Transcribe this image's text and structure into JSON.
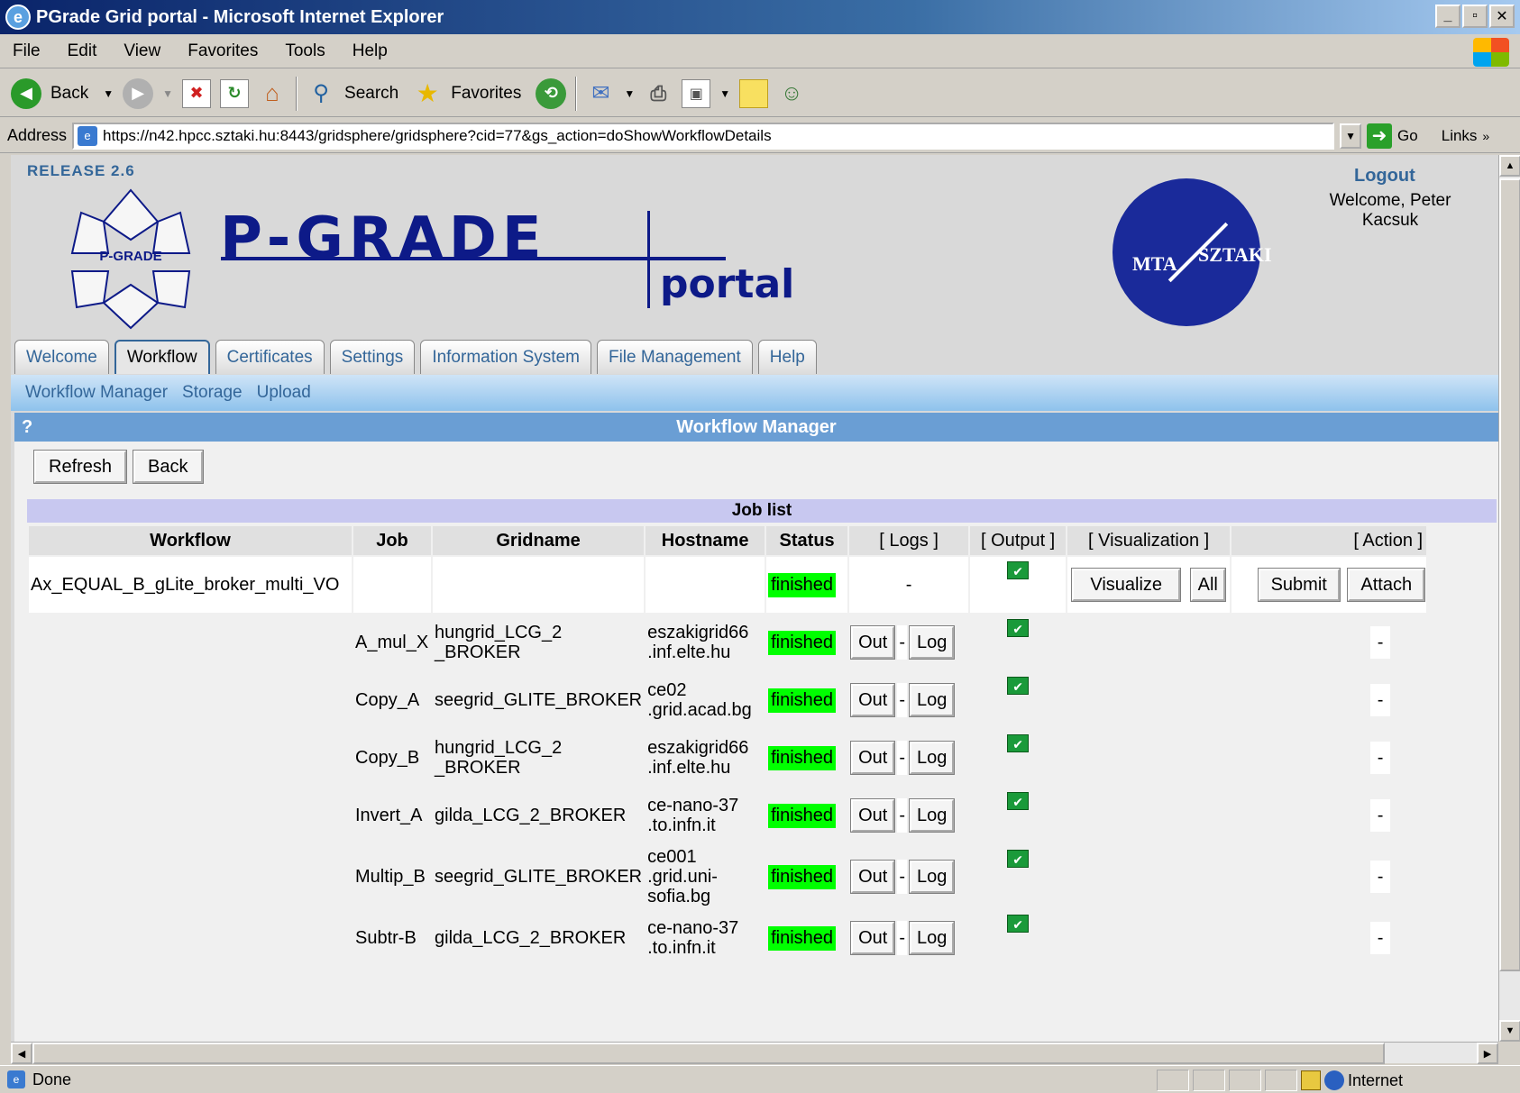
{
  "window": {
    "title": "PGrade Grid portal - Microsoft Internet Explorer"
  },
  "menu": [
    "File",
    "Edit",
    "View",
    "Favorites",
    "Tools",
    "Help"
  ],
  "toolbar": {
    "back": "Back",
    "search": "Search",
    "favorites": "Favorites"
  },
  "address": {
    "label": "Address",
    "url": "https://n42.hpcc.sztaki.hu:8443/gridsphere/gridsphere?cid=77&gs_action=doShowWorkflowDetails",
    "go": "Go",
    "links": "Links"
  },
  "page": {
    "release": "RELEASE 2.6",
    "logout": "Logout",
    "welcome": "Welcome, Peter Kacsuk",
    "logo": {
      "main": "P-GRADE",
      "sub": "portal",
      "mark": "P-GRADE",
      "mta_left": "MTA",
      "mta_right": "SZTAKI"
    },
    "tabs": [
      "Welcome",
      "Workflow",
      "Certificates",
      "Settings",
      "Information System",
      "File Management",
      "Help"
    ],
    "active_tab": "Workflow",
    "subnav": [
      "Workflow Manager",
      "Storage",
      "Upload"
    ],
    "panel": {
      "help": "?",
      "title": "Workflow Manager",
      "buttons": {
        "refresh": "Refresh",
        "back": "Back"
      },
      "job_list_title": "Job list",
      "headers": {
        "workflow": "Workflow",
        "job": "Job",
        "gridname": "Gridname",
        "hostname": "Hostname",
        "status": "Status",
        "logs": "[ Logs ]",
        "output": "[ Output ]",
        "visualization": "[ Visualization ]",
        "action": "[ Action ]"
      },
      "workflow_row": {
        "name": "Ax_EQUAL_B_gLite_broker_multi_VO",
        "status": "finished",
        "logs": "-",
        "visualize": "Visualize",
        "all": "All",
        "submit": "Submit",
        "attach": "Attach"
      },
      "jobs": [
        {
          "job": "A_mul_X",
          "gridname": "hungrid_LCG_2\n_BROKER",
          "hostname": "eszakigrid66\n.inf.elte.hu",
          "status": "finished",
          "out": "Out",
          "sep": "-",
          "log": "Log",
          "action": "-"
        },
        {
          "job": "Copy_A",
          "gridname": "seegrid_GLITE_BROKER",
          "hostname": "ce02\n.grid.acad.bg",
          "status": "finished",
          "out": "Out",
          "sep": "-",
          "log": "Log",
          "action": "-"
        },
        {
          "job": "Copy_B",
          "gridname": "hungrid_LCG_2\n_BROKER",
          "hostname": "eszakigrid66\n.inf.elte.hu",
          "status": "finished",
          "out": "Out",
          "sep": "-",
          "log": "Log",
          "action": "-"
        },
        {
          "job": "Invert_A",
          "gridname": "gilda_LCG_2_BROKER",
          "hostname": "ce-nano-37\n.to.infn.it",
          "status": "finished",
          "out": "Out",
          "sep": "-",
          "log": "Log",
          "action": "-"
        },
        {
          "job": "Multip_B",
          "gridname": "seegrid_GLITE_BROKER",
          "hostname": "ce001\n.grid.uni-\nsofia.bg",
          "status": "finished",
          "out": "Out",
          "sep": "-",
          "log": "Log",
          "action": "-"
        },
        {
          "job": "Subtr-B",
          "gridname": "gilda_LCG_2_BROKER",
          "hostname": "ce-nano-37\n.to.infn.it",
          "status": "finished",
          "out": "Out",
          "sep": "-",
          "log": "Log",
          "action": "-"
        }
      ]
    }
  },
  "status": {
    "text": "Done",
    "zone": "Internet"
  },
  "icons": [
    "ie-icon",
    "back-icon",
    "forward-icon",
    "stop-icon",
    "refresh-icon",
    "home-icon",
    "search-icon",
    "favorites-icon",
    "history-icon",
    "mail-icon",
    "print-icon",
    "edit-icon",
    "messenger-icon",
    "page-icon",
    "go-icon",
    "lock-icon",
    "globe-icon",
    "check-icon"
  ],
  "colors": {
    "accent": "#336699",
    "finished": "#00ff00",
    "logo_blue": "#0d1a88",
    "mta_blue": "#1a2a9a"
  }
}
